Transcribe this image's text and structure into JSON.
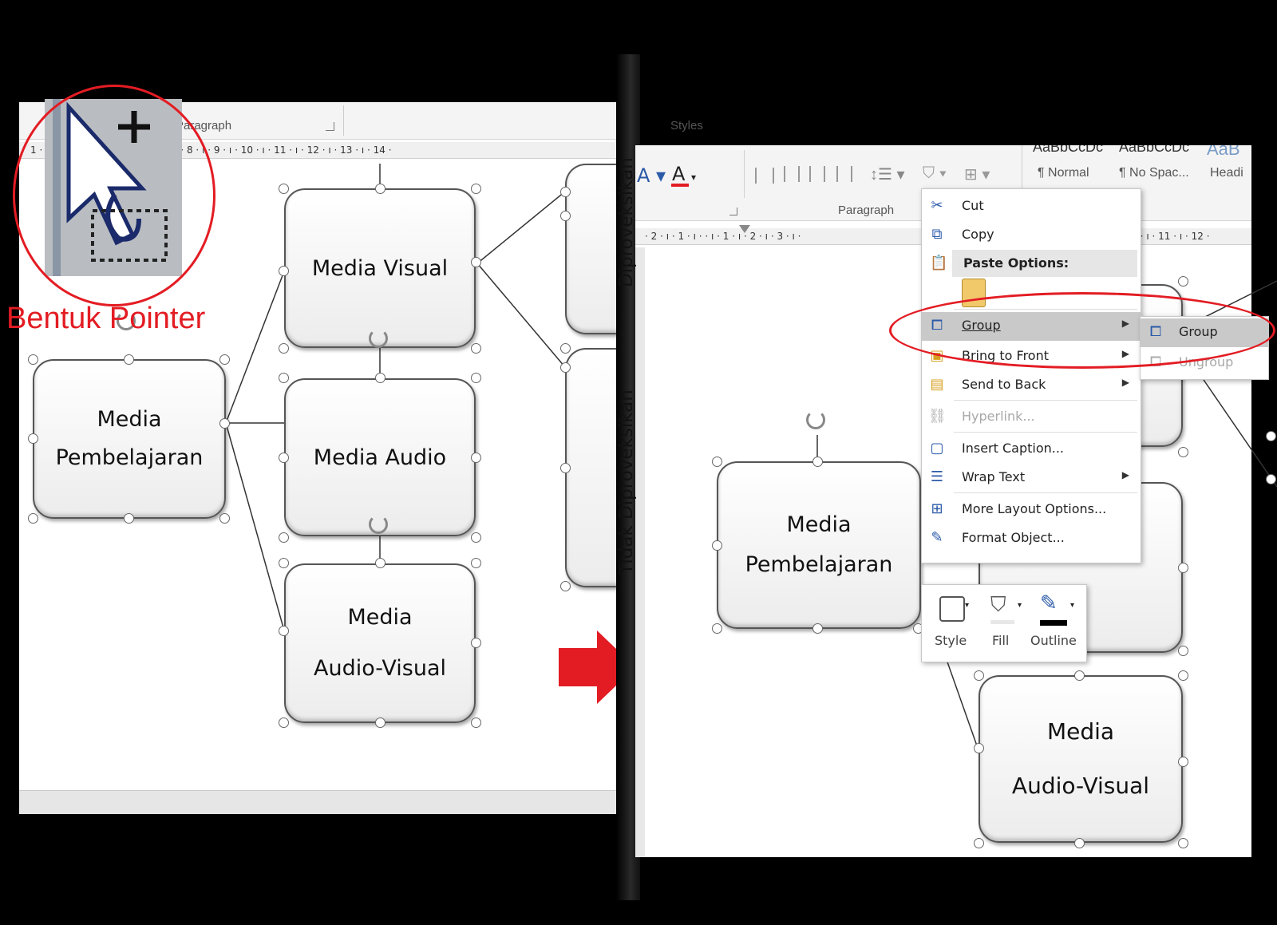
{
  "left_window": {
    "ribbon": {
      "paragraph_label": "Paragraph",
      "styles_label": "Styles"
    },
    "ruler_text": "1 · · 3 · ı · 4 · ı · 5 · ı · 6 · ı · 7 · ı · 8 · ı · 9 · ı · 10 · ı · 11 · ı · 12 · ı · 13 · ı · 14 ·",
    "shapes": {
      "root": [
        "Media",
        "Pembelajaran"
      ],
      "visual": "Media Visual",
      "audio": "Media Audio",
      "av": [
        "Media",
        "Audio-Visual"
      ]
    }
  },
  "pointer_callout": {
    "label": "Bentuk Pointer",
    "icon": "move-pointer-icon"
  },
  "vertical_texts": {
    "top": "Diproveksikan",
    "bottom": "Tidak Diproveksikan"
  },
  "right_window": {
    "ribbon": {
      "paragraph_label": "Paragraph",
      "styles": [
        "¶ Normal",
        "¶ No Spac...",
        "Headi"
      ],
      "style_previews": [
        "AaBbCcDc",
        "AaBbCcDc",
        "AaB"
      ]
    },
    "ruler_text": "· 2 · ı · 1 · ı ·    · ı · 1 · ı · 2 · ı · 3 · ı ·",
    "ruler_right": "· 10 · ı · 11 · ı · 12 ·",
    "shapes": {
      "root": [
        "Media",
        "Pembelajaran"
      ],
      "av": [
        "Media",
        "Audio-Visual"
      ]
    },
    "context_menu": {
      "items": [
        {
          "label": "Cut",
          "icon": "scissors-icon"
        },
        {
          "label": "Copy",
          "icon": "copy-icon"
        },
        {
          "label": "Paste Options:",
          "icon": "paste-icon"
        },
        {
          "label": "Group",
          "icon": "group-icon"
        },
        {
          "label": "Bring to Front",
          "icon": "bring-front-icon"
        },
        {
          "label": "Send to Back",
          "icon": "send-back-icon"
        },
        {
          "label": "Hyperlink...",
          "icon": "hyperlink-icon"
        },
        {
          "label": "Insert Caption...",
          "icon": "caption-icon"
        },
        {
          "label": "Wrap Text",
          "icon": "wrap-icon"
        },
        {
          "label": "More Layout Options...",
          "icon": "layout-icon"
        },
        {
          "label": "Format Object...",
          "icon": "format-icon"
        }
      ]
    },
    "submenu": {
      "items": [
        "Group",
        "Ungroup"
      ]
    },
    "mini_toolbar": {
      "items": [
        "Style",
        "Fill",
        "Outline"
      ]
    }
  },
  "colors": {
    "accent_red": "#e31c23"
  }
}
